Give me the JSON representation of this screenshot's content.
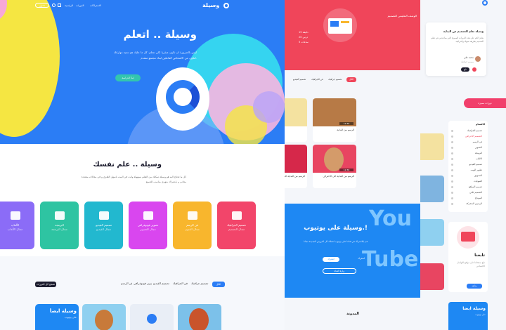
{
  "colors": {
    "hero_blue": "#2b7df5",
    "brand_red": "#f0455a",
    "yt_blue": "#1e88f3",
    "pink": "#f13f6b",
    "teal": "#33c6ae"
  },
  "nav": {
    "logo": "وسيلة",
    "items": [
      "الرئيسية",
      "الدورات",
      "الاشتراكات"
    ],
    "login_button": "دخول",
    "search_icon": "search-icon",
    "cart_icon": "cart-icon"
  },
  "hero": {
    "title": "وسيلة .. اتعلم",
    "subtitle_line1": "ليس بالضرورة ان تكون عبقريا لكي تتعلم. كل ما عليك هو تنمية مهاراتك",
    "subtitle_line2": "لتكون من الاشخاص الفاعلين لبناء مجتمع متقدم.",
    "cta": "ابدأ الدراسة"
  },
  "features": {
    "title": "وسيلة .. علم نفسك",
    "text_line1": "كل ما تحتاج اليه هو وسيلة تمكنك من التعلم بسهولة وانت في البيت باسهل الطرق و في مجالات متعددة",
    "text_line2": "مجانى و باشتراك شهري مناسب للجميع",
    "categories": [
      {
        "label": "تصميم الجرافيك",
        "sub": "مجال التصميم",
        "color": "#f2456a",
        "icon": "image-icon"
      },
      {
        "label": "فن الرسم",
        "sub": "مجال الفنون",
        "color": "#f8b62d",
        "icon": "compass-icon"
      },
      {
        "label": "تصوير فوتوغرافي",
        "sub": "مجال التصوير",
        "color": "#d946ef",
        "icon": "photo-icon"
      },
      {
        "label": "تصميم الفيديو",
        "sub": "مجال الفيديو",
        "color": "#22b8cf",
        "icon": "camera-icon"
      },
      {
        "label": "البرمجة",
        "sub": "مجال البرمجة",
        "color": "#2ec4a2",
        "icon": "code-icon"
      },
      {
        "label": "الألعاب",
        "sub": "مجال الألعاب",
        "color": "#8b6cf7",
        "icon": "gamepad-icon"
      }
    ]
  },
  "lower": {
    "tabs": [
      "الكل",
      "تصميم جرافيك",
      "فن الجرافيك",
      "تصميم الفيديو",
      "تصوير فوتوغرافي",
      "فن الرسم"
    ],
    "all_courses_button": "تصفح كل الدورات",
    "promo_title": "وسيلة ايضاً",
    "promo_sub": "على يوتيوب"
  },
  "mid": {
    "header_title": "الوصف التعليمي للتصميم",
    "header_meta": [
      "15 دقيقة",
      "20 درس",
      "5 ساعات"
    ],
    "tabs": [
      "الكل",
      "تصميم جرافيك",
      "فن الجرافيك",
      "تصميم الفيديو"
    ],
    "videos": [
      {
        "title": "الرسم من البداية",
        "duration": "12:30"
      },
      {
        "title": "الرسم من البداية الى الاحتراف",
        "duration": "12:30"
      },
      {
        "title": "الرسم من البداية الى الاحتراف",
        "duration": "12:30"
      },
      {
        "title": "الرسم من البداية الى الاحتراف",
        "duration": "12:30"
      }
    ],
    "yt_title": "وسيلة على يوتيوب.!",
    "yt_text": "قم بالاشتراك في قناتنا على يوتيوب لتصلك كل الدروس الجديدة مجانا",
    "yt_subscribe": "اشترك",
    "yt_visit": "زيارة القناة",
    "yt_big_text": [
      "You",
      "Tube"
    ],
    "blog_title": "المدونة"
  },
  "right": {
    "testimonial_title": "وسيلة تعلم التصميم من البداية",
    "testimonial_text": "شكرا لكم على هذه الدورات المميزة التي ساعدتني في تعلم التصميم بطريقة سهلة واحترافية",
    "author": "محمد علي",
    "author_role": "مصمم جرافيك",
    "follow_button": "تابع",
    "pill_label": "دورات مميزة",
    "sidebar_title": "الاقسام",
    "sidebar_items": [
      "تصميم الجرافيك",
      "التصميم الاحترافي",
      "فن الرسم",
      "التصوير",
      "البرمجة",
      "الالعاب",
      "تصميم الفيديو",
      "تطوير الويب",
      "التسويق",
      "الصوتيات",
      "تصميم المواقع",
      "التصميم ثلاثي",
      "المونتاج",
      "الرسوم المتحركة"
    ],
    "follow_title": "تابعنا",
    "follow_text": "تابع صفحاتنا على مواقع التواصل الاجتماعي",
    "follow_btn": "متابعة",
    "promo_title": "وسيلة ايضاً",
    "promo_sub": "على يوتيوب"
  }
}
